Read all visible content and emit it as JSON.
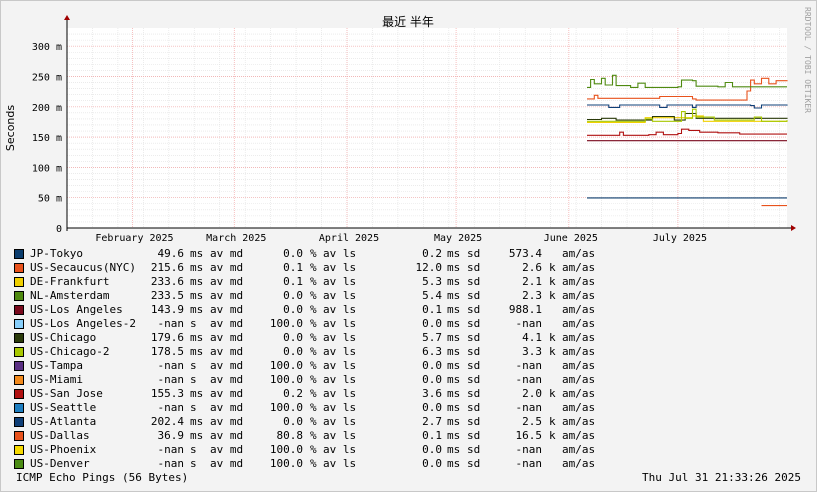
{
  "chart_data": {
    "type": "line",
    "title": "最近 半年",
    "ylabel": "Seconds",
    "watermark": "RRDTOOL / TOBI OETIKER",
    "ylim": [
      0,
      0.33
    ],
    "y_ticks": [
      {
        "value": 0,
        "label": "0"
      },
      {
        "value": 0.05,
        "label": "50 m"
      },
      {
        "value": 0.1,
        "label": "100 m"
      },
      {
        "value": 0.15,
        "label": "150 m"
      },
      {
        "value": 0.2,
        "label": "200 m"
      },
      {
        "value": 0.25,
        "label": "250 m"
      },
      {
        "value": 0.3,
        "label": "300 m"
      }
    ],
    "x_range": [
      "2025-01-14",
      "2025-07-31"
    ],
    "x_ticks": [
      {
        "date": "2025-02-01",
        "label": "February 2025"
      },
      {
        "date": "2025-03-01",
        "label": "March 2025"
      },
      {
        "date": "2025-04-01",
        "label": "April 2025"
      },
      {
        "date": "2025-05-01",
        "label": "May 2025"
      },
      {
        "date": "2025-06-01",
        "label": "June 2025"
      },
      {
        "date": "2025-07-01",
        "label": "July 2025"
      }
    ],
    "grid": true,
    "series": [
      {
        "name": "JP-Tokyo",
        "color": "#0b3d6e",
        "points": [
          [
            "2025-06-06",
            0.0496
          ],
          [
            "2025-07-31",
            0.0496
          ]
        ]
      },
      {
        "name": "US-Secaucus(NYC)",
        "color": "#e8521c",
        "points": [
          [
            "2025-06-06",
            0.213
          ],
          [
            "2025-06-08",
            0.219
          ],
          [
            "2025-06-09",
            0.214
          ],
          [
            "2025-06-25",
            0.214
          ],
          [
            "2025-06-26",
            0.217
          ],
          [
            "2025-07-05",
            0.213
          ],
          [
            "2025-07-06",
            0.211
          ],
          [
            "2025-07-18",
            0.211
          ],
          [
            "2025-07-20",
            0.226
          ],
          [
            "2025-07-21",
            0.244
          ],
          [
            "2025-07-22",
            0.238
          ],
          [
            "2025-07-24",
            0.247
          ],
          [
            "2025-07-26",
            0.238
          ],
          [
            "2025-07-28",
            0.243
          ],
          [
            "2025-07-31",
            0.242
          ]
        ]
      },
      {
        "name": "DE-Frankfurt",
        "color": "#f0d000",
        "points": [
          [
            "2025-06-06",
            0.174
          ],
          [
            "2025-06-20",
            0.174
          ],
          [
            "2025-06-22",
            0.182
          ],
          [
            "2025-07-03",
            0.182
          ],
          [
            "2025-07-05",
            0.185
          ],
          [
            "2025-07-08",
            0.176
          ],
          [
            "2025-07-31",
            0.176
          ]
        ]
      },
      {
        "name": "NL-Amsterdam",
        "color": "#4f8a10",
        "points": [
          [
            "2025-06-06",
            0.232
          ],
          [
            "2025-06-07",
            0.245
          ],
          [
            "2025-06-08",
            0.238
          ],
          [
            "2025-06-10",
            0.247
          ],
          [
            "2025-06-11",
            0.236
          ],
          [
            "2025-06-13",
            0.252
          ],
          [
            "2025-06-14",
            0.235
          ],
          [
            "2025-06-18",
            0.232
          ],
          [
            "2025-06-20",
            0.239
          ],
          [
            "2025-06-22",
            0.232
          ],
          [
            "2025-07-01",
            0.233
          ],
          [
            "2025-07-02",
            0.244
          ],
          [
            "2025-07-05",
            0.243
          ],
          [
            "2025-07-06",
            0.234
          ],
          [
            "2025-07-12",
            0.233
          ],
          [
            "2025-07-14",
            0.24
          ],
          [
            "2025-07-16",
            0.233
          ],
          [
            "2025-07-31",
            0.233
          ]
        ]
      },
      {
        "name": "US-Los Angeles",
        "color": "#7a0a1e",
        "points": [
          [
            "2025-06-06",
            0.144
          ],
          [
            "2025-07-31",
            0.144
          ]
        ]
      },
      {
        "name": "US-Los Angeles-2",
        "color": "#87cefa",
        "points": []
      },
      {
        "name": "US-Chicago",
        "color": "#2a3a0a",
        "points": [
          [
            "2025-06-06",
            0.179
          ],
          [
            "2025-06-10",
            0.181
          ],
          [
            "2025-06-14",
            0.178
          ],
          [
            "2025-06-24",
            0.184
          ],
          [
            "2025-06-30",
            0.178
          ],
          [
            "2025-07-03",
            0.189
          ],
          [
            "2025-07-06",
            0.181
          ],
          [
            "2025-07-31",
            0.18
          ]
        ]
      },
      {
        "name": "US-Chicago-2",
        "color": "#a8c800",
        "points": [
          [
            "2025-06-06",
            0.176
          ],
          [
            "2025-06-20",
            0.176
          ],
          [
            "2025-06-22",
            0.18
          ],
          [
            "2025-06-24",
            0.176
          ],
          [
            "2025-07-02",
            0.192
          ],
          [
            "2025-07-03",
            0.181
          ],
          [
            "2025-07-05",
            0.196
          ],
          [
            "2025-07-06",
            0.183
          ],
          [
            "2025-07-11",
            0.178
          ],
          [
            "2025-07-20",
            0.178
          ],
          [
            "2025-07-22",
            0.183
          ],
          [
            "2025-07-24",
            0.176
          ],
          [
            "2025-07-31",
            0.178
          ]
        ]
      },
      {
        "name": "US-Tampa",
        "color": "#5a2f83",
        "points": []
      },
      {
        "name": "US-Miami",
        "color": "#f28a1e",
        "points": []
      },
      {
        "name": "US-San Jose",
        "color": "#b01010",
        "points": [
          [
            "2025-06-06",
            0.153
          ],
          [
            "2025-06-14",
            0.153
          ],
          [
            "2025-06-15",
            0.158
          ],
          [
            "2025-06-16",
            0.153
          ],
          [
            "2025-06-23",
            0.154
          ],
          [
            "2025-06-25",
            0.158
          ],
          [
            "2025-06-27",
            0.154
          ],
          [
            "2025-07-01",
            0.156
          ],
          [
            "2025-07-02",
            0.163
          ],
          [
            "2025-07-04",
            0.161
          ],
          [
            "2025-07-07",
            0.158
          ],
          [
            "2025-07-12",
            0.157
          ],
          [
            "2025-07-18",
            0.155
          ],
          [
            "2025-07-31",
            0.155
          ]
        ]
      },
      {
        "name": "US-Seattle",
        "color": "#1e7ec0",
        "points": []
      },
      {
        "name": "US-Atlanta",
        "color": "#0f3f77",
        "points": [
          [
            "2025-06-06",
            0.203
          ],
          [
            "2025-06-10",
            0.203
          ],
          [
            "2025-06-12",
            0.199
          ],
          [
            "2025-06-15",
            0.203
          ],
          [
            "2025-06-24",
            0.203
          ],
          [
            "2025-06-26",
            0.199
          ],
          [
            "2025-06-28",
            0.203
          ],
          [
            "2025-07-05",
            0.199
          ],
          [
            "2025-07-06",
            0.203
          ],
          [
            "2025-07-21",
            0.202
          ],
          [
            "2025-07-22",
            0.198
          ],
          [
            "2025-07-24",
            0.203
          ],
          [
            "2025-07-31",
            0.202
          ]
        ]
      },
      {
        "name": "US-Dallas",
        "color": "#e8521c",
        "points": [
          [
            "2025-07-24",
            0.0369
          ],
          [
            "2025-07-31",
            0.0369
          ]
        ]
      },
      {
        "name": "US-Phoenix",
        "color": "#f5d800",
        "points": []
      },
      {
        "name": "US-Denver",
        "color": "#4b8c14",
        "points": []
      }
    ]
  },
  "legend": [
    {
      "name": "JP-Tokyo",
      "avg": "49.6",
      "avg_unit": "ms",
      "loss": "0.0",
      "sd": "0.2",
      "sd_unit": "ms",
      "amas": "573.4",
      "amas_prefix": ""
    },
    {
      "name": "US-Secaucus(NYC)",
      "avg": "215.6",
      "avg_unit": "ms",
      "loss": "0.1",
      "sd": "12.0",
      "sd_unit": "ms",
      "amas": "2.6",
      "amas_prefix": "k"
    },
    {
      "name": "DE-Frankfurt",
      "avg": "233.6",
      "avg_unit": "ms",
      "loss": "0.1",
      "sd": "5.3",
      "sd_unit": "ms",
      "amas": "2.1",
      "amas_prefix": "k"
    },
    {
      "name": "NL-Amsterdam",
      "avg": "233.5",
      "avg_unit": "ms",
      "loss": "0.0",
      "sd": "5.4",
      "sd_unit": "ms",
      "amas": "2.3",
      "amas_prefix": "k"
    },
    {
      "name": "US-Los Angeles",
      "avg": "143.9",
      "avg_unit": "ms",
      "loss": "0.0",
      "sd": "0.1",
      "sd_unit": "ms",
      "amas": "988.1",
      "amas_prefix": ""
    },
    {
      "name": "US-Los Angeles-2",
      "avg": "-nan",
      "avg_unit": "s",
      "loss": "100.0",
      "sd": "0.0",
      "sd_unit": "ms",
      "amas": "-nan",
      "amas_prefix": ""
    },
    {
      "name": "US-Chicago",
      "avg": "179.6",
      "avg_unit": "ms",
      "loss": "0.0",
      "sd": "5.7",
      "sd_unit": "ms",
      "amas": "4.1",
      "amas_prefix": "k"
    },
    {
      "name": "US-Chicago-2",
      "avg": "178.5",
      "avg_unit": "ms",
      "loss": "0.0",
      "sd": "6.3",
      "sd_unit": "ms",
      "amas": "3.3",
      "amas_prefix": "k"
    },
    {
      "name": "US-Tampa",
      "avg": "-nan",
      "avg_unit": "s",
      "loss": "100.0",
      "sd": "0.0",
      "sd_unit": "ms",
      "amas": "-nan",
      "amas_prefix": ""
    },
    {
      "name": "US-Miami",
      "avg": "-nan",
      "avg_unit": "s",
      "loss": "100.0",
      "sd": "0.0",
      "sd_unit": "ms",
      "amas": "-nan",
      "amas_prefix": ""
    },
    {
      "name": "US-San Jose",
      "avg": "155.3",
      "avg_unit": "ms",
      "loss": "0.2",
      "sd": "3.6",
      "sd_unit": "ms",
      "amas": "2.0",
      "amas_prefix": "k"
    },
    {
      "name": "US-Seattle",
      "avg": "-nan",
      "avg_unit": "s",
      "loss": "100.0",
      "sd": "0.0",
      "sd_unit": "ms",
      "amas": "-nan",
      "amas_prefix": ""
    },
    {
      "name": "US-Atlanta",
      "avg": "202.4",
      "avg_unit": "ms",
      "loss": "0.0",
      "sd": "2.7",
      "sd_unit": "ms",
      "amas": "2.5",
      "amas_prefix": "k"
    },
    {
      "name": "US-Dallas",
      "avg": "36.9",
      "avg_unit": "ms",
      "loss": "80.8",
      "sd": "0.1",
      "sd_unit": "ms",
      "amas": "16.5",
      "amas_prefix": "k"
    },
    {
      "name": "US-Phoenix",
      "avg": "-nan",
      "avg_unit": "s",
      "loss": "100.0",
      "sd": "0.0",
      "sd_unit": "ms",
      "amas": "-nan",
      "amas_prefix": ""
    },
    {
      "name": "US-Denver",
      "avg": "-nan",
      "avg_unit": "s",
      "loss": "100.0",
      "sd": "0.0",
      "sd_unit": "ms",
      "amas": "-nan",
      "amas_prefix": ""
    }
  ],
  "legend_colors": [
    "#0b3d6e",
    "#e8521c",
    "#f0d000",
    "#4f8a10",
    "#7a0a1e",
    "#87cefa",
    "#2a3a0a",
    "#a8c800",
    "#5a2f83",
    "#f28a1e",
    "#b01010",
    "#1e7ec0",
    "#0f3f77",
    "#e8521c",
    "#f5d800",
    "#4b8c14"
  ],
  "labels": {
    "av_md": "av md",
    "pct": "%",
    "av_ls": "av ls",
    "sd": "sd",
    "amas": "am/as"
  },
  "footer": {
    "left": "ICMP Echo Pings (56 Bytes)",
    "right": "Thu Jul 31 21:33:26 2025"
  }
}
